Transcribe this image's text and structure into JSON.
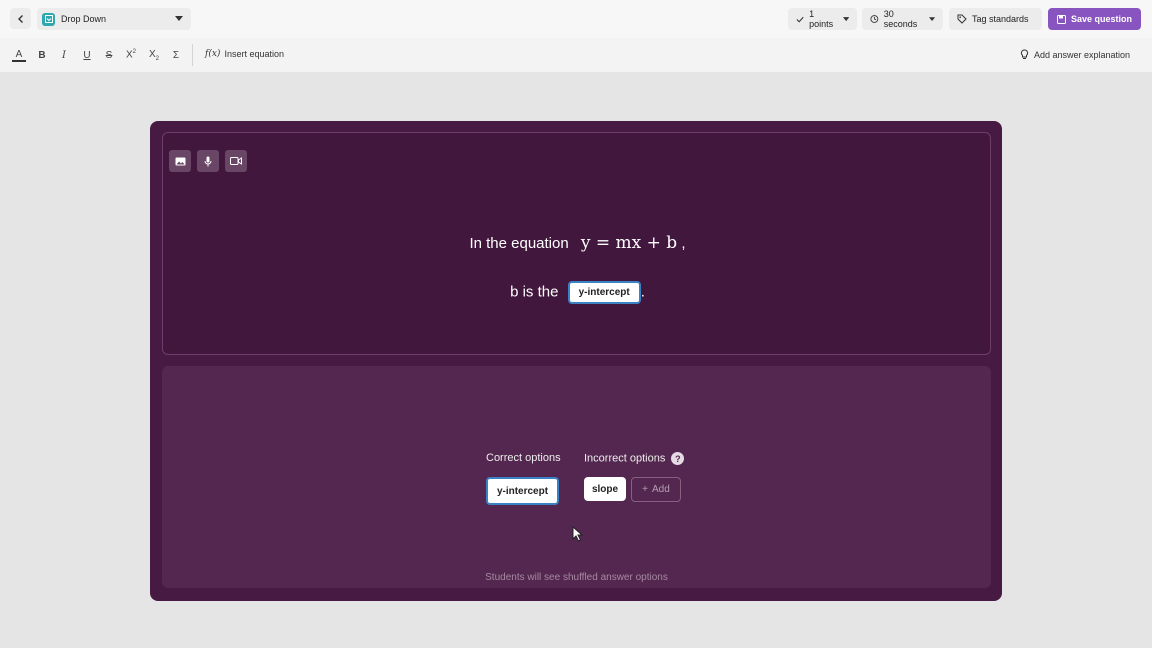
{
  "header": {
    "question_type": "Drop Down",
    "points": "1 points",
    "time": "30 seconds",
    "tag_label": "Tag standards",
    "save_label": "Save question"
  },
  "toolbar": {
    "insert_equation": "Insert equation",
    "answer_explanation": "Add answer explanation"
  },
  "question": {
    "line1_text": "In the equation",
    "equation": "y = mx + b",
    "line1_end": ",",
    "line2_text": "b is the",
    "blank_value": "y-intercept",
    "line2_end": "."
  },
  "options": {
    "correct_heading": "Correct options",
    "incorrect_heading": "Incorrect options",
    "help_glyph": "?",
    "correct": [
      "y-intercept"
    ],
    "incorrect": [
      "slope"
    ],
    "add_label": "Add",
    "note": "Students will see shuffled answer options"
  },
  "colors": {
    "accent": "#8854c0",
    "card": "#461a42",
    "blank_border": "#3a82c4"
  }
}
